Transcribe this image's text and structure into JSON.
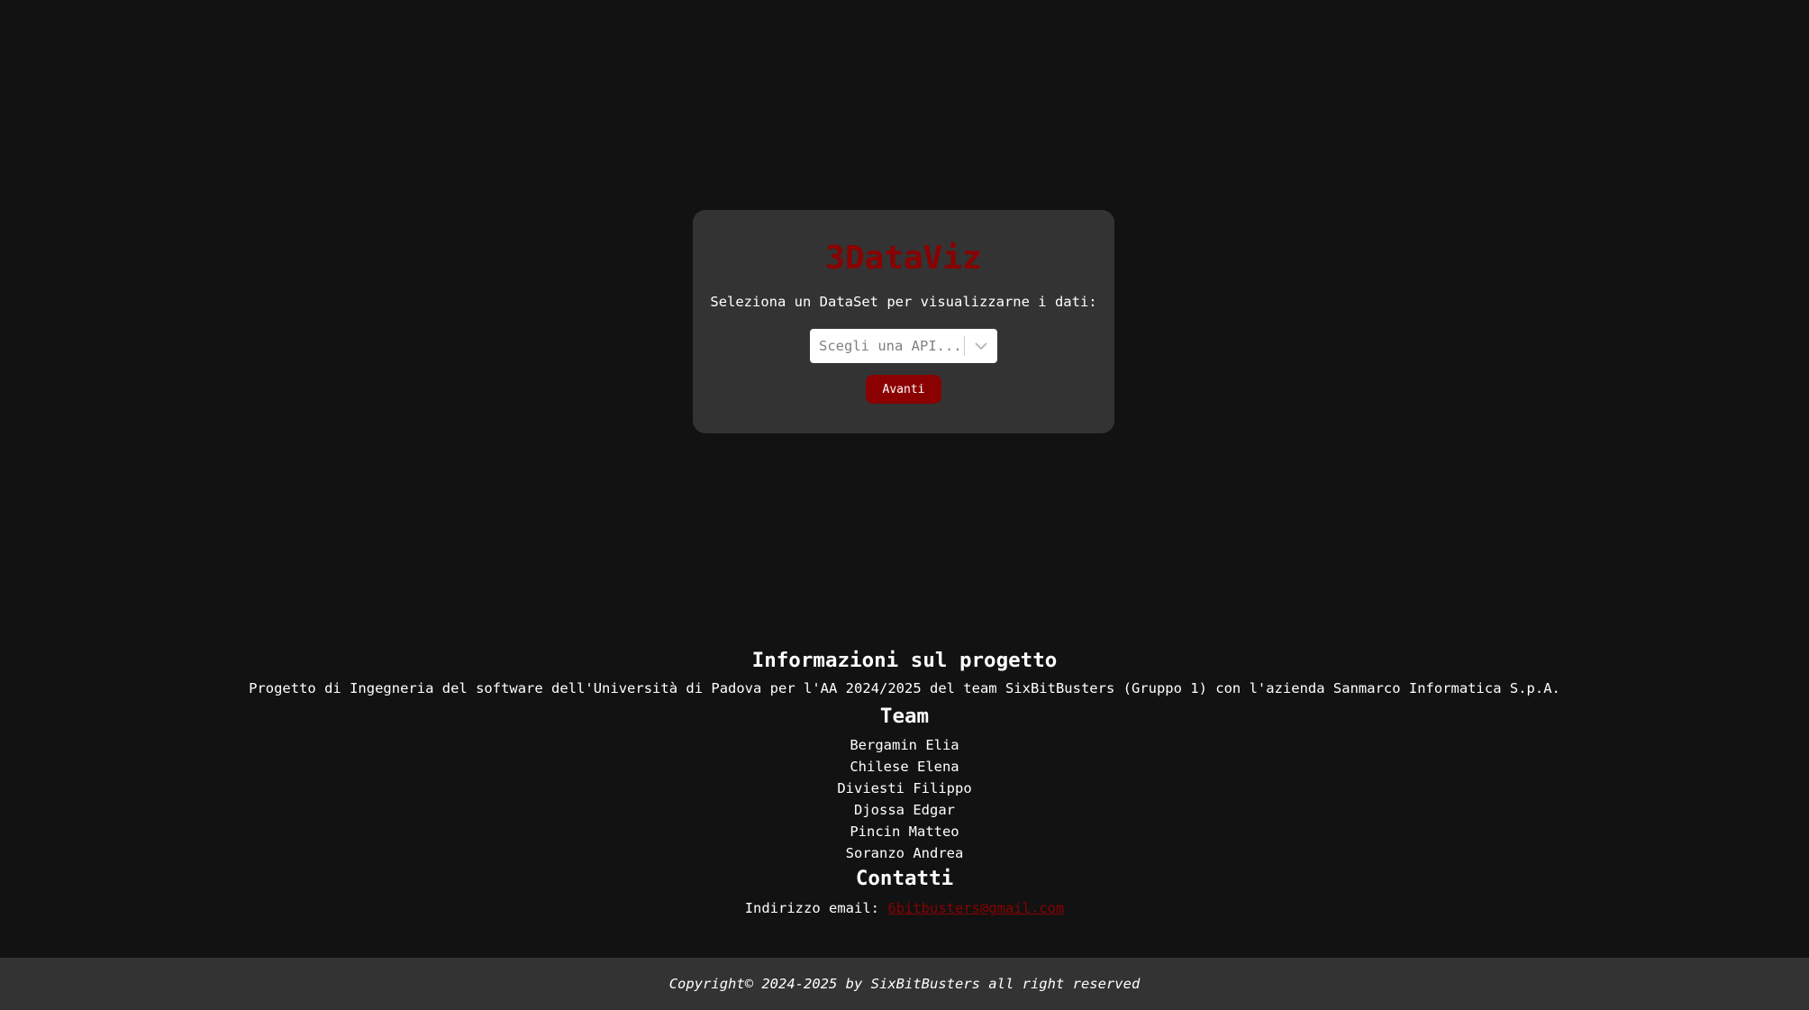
{
  "app": {
    "title": "3DataViz",
    "subtitle": "Seleziona un DataSet per visualizzarne i dati:",
    "select_placeholder": "Scegli una API...",
    "next_button": "Avanti"
  },
  "info": {
    "project_heading": "Informazioni sul progetto",
    "project_description": "Progetto di Ingegneria del software dell'Università di Padova per l'AA 2024/2025 del team SixBitBusters (Gruppo 1) con l'azienda Sanmarco Informatica S.p.A.",
    "team_heading": "Team",
    "team_members": [
      "Bergamin Elia",
      "Chilese Elena",
      "Diviesti Filippo",
      "Djossa Edgar",
      "Pincin Matteo",
      "Soranzo Andrea"
    ],
    "contacts_heading": "Contatti",
    "email_label": "Indirizzo email:",
    "email_address": "6bitbusters@gmail.com"
  },
  "footer": {
    "copyright": "Copyright© 2024-2025 by SixBitBusters all right reserved"
  },
  "colors": {
    "background": "#121212",
    "card": "#333333",
    "accent": "#8b0000",
    "text": "#ffffff"
  },
  "icons": {
    "select_arrow": "chevron-down-icon"
  }
}
